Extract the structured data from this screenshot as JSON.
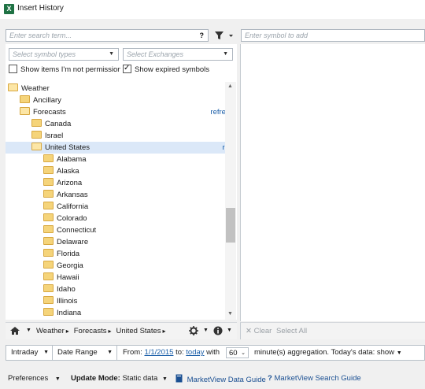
{
  "window": {
    "title": "Insert History",
    "app_icon": "X"
  },
  "search": {
    "placeholder": "Enter search term...",
    "help": "?",
    "symbol_placeholder": "Enter symbol to add"
  },
  "filters": {
    "symbol_types": "Select symbol types",
    "exchanges": "Select Exchanges",
    "not_permissioned": "Show items I'm not permissionec",
    "expired": "Show expired symbols"
  },
  "tree": [
    {
      "label": "Weather",
      "level": 0,
      "open": true,
      "refresh": "",
      "selected": false
    },
    {
      "label": "Ancillary",
      "level": 1,
      "open": false,
      "refresh": "",
      "selected": false
    },
    {
      "label": "Forecasts",
      "level": 1,
      "open": true,
      "refresh": "refresh",
      "selected": false
    },
    {
      "label": "Canada",
      "level": 2,
      "open": false,
      "refresh": "",
      "selected": false
    },
    {
      "label": "Israel",
      "level": 2,
      "open": false,
      "refresh": "",
      "selected": false
    },
    {
      "label": "United States",
      "level": 2,
      "open": true,
      "refresh": "refresh",
      "selected": true
    },
    {
      "label": "Alabama",
      "level": 3,
      "open": false,
      "refresh": "",
      "selected": false
    },
    {
      "label": "Alaska",
      "level": 3,
      "open": false,
      "refresh": "",
      "selected": false
    },
    {
      "label": "Arizona",
      "level": 3,
      "open": false,
      "refresh": "",
      "selected": false
    },
    {
      "label": "Arkansas",
      "level": 3,
      "open": false,
      "refresh": "",
      "selected": false
    },
    {
      "label": "California",
      "level": 3,
      "open": false,
      "refresh": "",
      "selected": false
    },
    {
      "label": "Colorado",
      "level": 3,
      "open": false,
      "refresh": "",
      "selected": false
    },
    {
      "label": "Connecticut",
      "level": 3,
      "open": false,
      "refresh": "",
      "selected": false
    },
    {
      "label": "Delaware",
      "level": 3,
      "open": false,
      "refresh": "",
      "selected": false
    },
    {
      "label": "Florida",
      "level": 3,
      "open": false,
      "refresh": "",
      "selected": false
    },
    {
      "label": "Georgia",
      "level": 3,
      "open": false,
      "refresh": "",
      "selected": false
    },
    {
      "label": "Hawaii",
      "level": 3,
      "open": false,
      "refresh": "",
      "selected": false
    },
    {
      "label": "Idaho",
      "level": 3,
      "open": false,
      "refresh": "",
      "selected": false
    },
    {
      "label": "Illinois",
      "level": 3,
      "open": false,
      "refresh": "",
      "selected": false
    },
    {
      "label": "Indiana",
      "level": 3,
      "open": false,
      "refresh": "",
      "selected": false
    }
  ],
  "breadcrumb": [
    "Weather",
    "Forecasts",
    "United States"
  ],
  "right_actions": {
    "clear": "Clear",
    "select_all": "Select All"
  },
  "range_bar": {
    "interval": "Intraday",
    "mode": "Date Range",
    "from_label": "From:",
    "from_value": "1/1/2015",
    "to_label": "to:",
    "to_value": "today",
    "with_label": "with",
    "minutes": "60",
    "aggregation_text": "minute(s) aggregation.",
    "today_label": "Today's data:",
    "today_value": "show"
  },
  "footer": {
    "preferences": "Preferences",
    "update_mode_label": "Update Mode:",
    "update_mode_value": "Static data",
    "data_guide": "MarketView Data Guide",
    "search_guide": "MarketView Search Guide"
  },
  "colors": {
    "excel_green": "#1f7244",
    "link_blue": "#1a5ea8",
    "selection": "#dbe8f8",
    "folder": "#f5d47a"
  }
}
